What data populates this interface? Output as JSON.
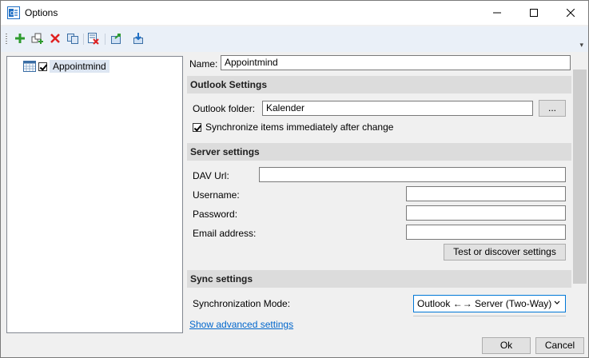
{
  "window": {
    "title": "Options"
  },
  "title_controls": {
    "minimize": "—",
    "maximize": "☐",
    "close": "✕"
  },
  "toolbar": {
    "icons": [
      "add-icon",
      "add-multiple-icon",
      "delete-icon",
      "copy-icon",
      "clear-cache-icon",
      "export-icon",
      "import-icon"
    ],
    "overflow": "▾"
  },
  "tree": {
    "items": [
      {
        "label": "Appointmind",
        "checked": true
      }
    ]
  },
  "form": {
    "name_label": "Name:",
    "name_value": "Appointmind",
    "outlook_section": "Outlook Settings",
    "outlook_folder_label": "Outlook folder:",
    "outlook_folder_value": "Kalender",
    "browse_label": "...",
    "sync_immediately_label": "Synchronize items immediately after change",
    "sync_immediately_checked": true,
    "server_section": "Server settings",
    "dav_url_label": "DAV Url:",
    "dav_url_value": "",
    "username_label": "Username:",
    "username_value": "",
    "password_label": "Password:",
    "password_value": "",
    "email_label": "Email address:",
    "email_value": "",
    "test_button": "Test or discover settings",
    "sync_section": "Sync settings",
    "sync_mode_label": "Synchronization Mode:",
    "sync_mode_value": "Outlook ←→ Server (Two-Way)",
    "advanced_link": "Show advanced settings"
  },
  "footer": {
    "ok": "Ok",
    "cancel": "Cancel"
  }
}
